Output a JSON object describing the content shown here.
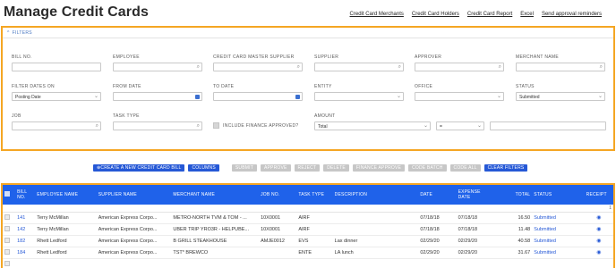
{
  "page": {
    "title": "Manage Credit Cards",
    "top_links": [
      "Credit Card Merchants",
      "Credit Card Holders",
      "Credit Card Report",
      "Excel",
      "Send approval reminders"
    ]
  },
  "filters": {
    "header": "FILTERS",
    "fields": {
      "bill_no": {
        "label": "BILL NO.",
        "value": ""
      },
      "employee": {
        "label": "EMPLOYEE",
        "value": ""
      },
      "master_supplier": {
        "label": "CREDIT CARD MASTER SUPPLIER",
        "value": ""
      },
      "supplier": {
        "label": "SUPPLIER",
        "value": ""
      },
      "approver": {
        "label": "APPROVER",
        "value": ""
      },
      "merchant_name": {
        "label": "MERCHANT NAME",
        "value": ""
      },
      "filter_dates_on": {
        "label": "FILTER DATES ON",
        "value": "Posting Date"
      },
      "from_date": {
        "label": "FROM DATE",
        "value": ""
      },
      "to_date": {
        "label": "TO DATE",
        "value": ""
      },
      "entity": {
        "label": "ENTITY",
        "value": ""
      },
      "office": {
        "label": "OFFICE",
        "value": ""
      },
      "status": {
        "label": "STATUS",
        "value": "Submitted"
      },
      "job": {
        "label": "JOB",
        "value": ""
      },
      "task_type": {
        "label": "TASK TYPE",
        "value": ""
      },
      "include_finance": {
        "label": "INCLUDE FINANCE APPROVED?"
      },
      "amount": {
        "label": "AMOUNT",
        "value": "Total",
        "operator": "=",
        "amount_value": ""
      }
    }
  },
  "actions": {
    "new_bill": "CREATE A NEW CREDIT CARD BILL",
    "columns": "COLUMNS",
    "submit": "SUBMIT",
    "approve": "APPROVE",
    "reject": "REJECT",
    "delete": "DELETE",
    "finance_approve": "FINANCE APPROVE",
    "code_batch": "CODE BATCH",
    "code_all": "CODE ALL",
    "clear_filters": "CLEAR FILTERS"
  },
  "table": {
    "headers": {
      "bill_no_1": "BILL",
      "bill_no_2": "NO.",
      "employee": "EMPLOYEE NAME",
      "supplier": "SUPPLIER NAME",
      "merchant": "MERCHANT NAME",
      "job": "JOB NO.",
      "task": "TASK TYPE",
      "description": "DESCRIPTION",
      "date": "DATE",
      "expense_1": "EXPENSE",
      "expense_2": "DATE",
      "total": "TOTAL",
      "status": "STATUS",
      "receipt": "RECEIPT"
    },
    "filter_count": "1",
    "rows": [
      {
        "bill": "141",
        "employee": "Terry McMillan",
        "supplier": "American Express Corpo...",
        "merchant": "METRO-NORTH TVM & TOM - ...",
        "job": "10X0001",
        "task": "AIRF",
        "description": "",
        "date": "07/18/18",
        "expense_date": "07/18/18",
        "total": "16.50",
        "status": "Submitted"
      },
      {
        "bill": "142",
        "employee": "Terry McMillan",
        "supplier": "American Express Corpo...",
        "merchant": "UBER TRIP YRO3R - HELPUBE...",
        "job": "10X0001",
        "task": "AIRF",
        "description": "",
        "date": "07/18/18",
        "expense_date": "07/18/18",
        "total": "11.48",
        "status": "Submitted"
      },
      {
        "bill": "182",
        "employee": "Rhett Ledford",
        "supplier": "American Express Corpo...",
        "merchant": "B GRILL STEAKHOUSE",
        "job": "AMJE0012",
        "task": "EVS",
        "description": "Lax dinner",
        "date": "02/29/20",
        "expense_date": "02/29/20",
        "total": "40.58",
        "status": "Submitted"
      },
      {
        "bill": "184",
        "employee": "Rhett Ledford",
        "supplier": "American Express Corpo...",
        "merchant": "TST* BREWCO",
        "job": "",
        "task": "ENTE",
        "description": "LA lunch",
        "date": "02/29/20",
        "expense_date": "02/29/20",
        "total": "31.67",
        "status": "Submitted"
      },
      {
        "bill": "",
        "employee": "",
        "supplier": "",
        "merchant": "",
        "job": "",
        "task": "",
        "description": "",
        "date": "",
        "expense_date": "",
        "total": "",
        "status": ""
      }
    ]
  }
}
